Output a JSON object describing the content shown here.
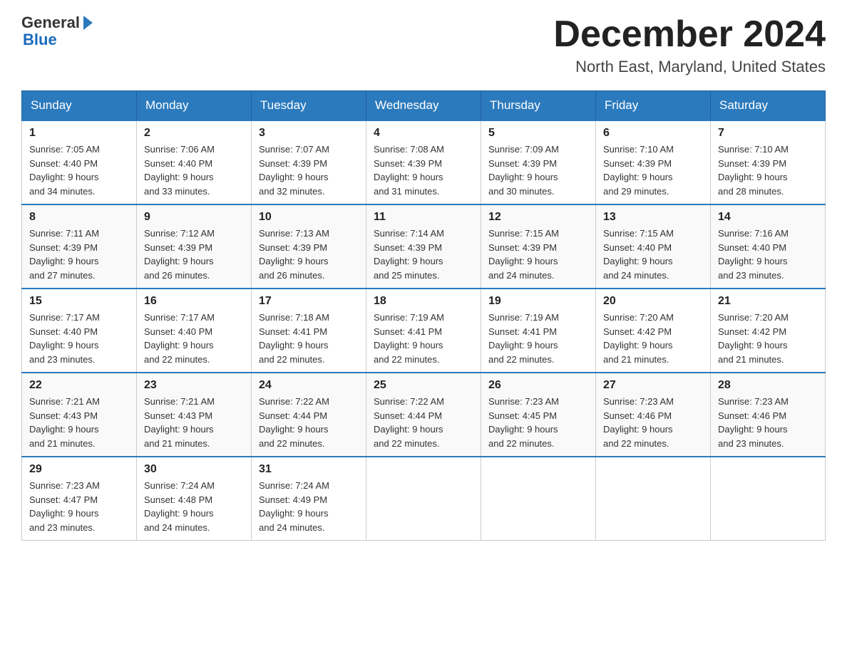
{
  "header": {
    "logo_general": "General",
    "logo_blue": "Blue",
    "month_title": "December 2024",
    "location": "North East, Maryland, United States"
  },
  "weekdays": [
    "Sunday",
    "Monday",
    "Tuesday",
    "Wednesday",
    "Thursday",
    "Friday",
    "Saturday"
  ],
  "weeks": [
    [
      {
        "day": "1",
        "sunrise": "7:05 AM",
        "sunset": "4:40 PM",
        "daylight": "9 hours and 34 minutes."
      },
      {
        "day": "2",
        "sunrise": "7:06 AM",
        "sunset": "4:40 PM",
        "daylight": "9 hours and 33 minutes."
      },
      {
        "day": "3",
        "sunrise": "7:07 AM",
        "sunset": "4:39 PM",
        "daylight": "9 hours and 32 minutes."
      },
      {
        "day": "4",
        "sunrise": "7:08 AM",
        "sunset": "4:39 PM",
        "daylight": "9 hours and 31 minutes."
      },
      {
        "day": "5",
        "sunrise": "7:09 AM",
        "sunset": "4:39 PM",
        "daylight": "9 hours and 30 minutes."
      },
      {
        "day": "6",
        "sunrise": "7:10 AM",
        "sunset": "4:39 PM",
        "daylight": "9 hours and 29 minutes."
      },
      {
        "day": "7",
        "sunrise": "7:10 AM",
        "sunset": "4:39 PM",
        "daylight": "9 hours and 28 minutes."
      }
    ],
    [
      {
        "day": "8",
        "sunrise": "7:11 AM",
        "sunset": "4:39 PM",
        "daylight": "9 hours and 27 minutes."
      },
      {
        "day": "9",
        "sunrise": "7:12 AM",
        "sunset": "4:39 PM",
        "daylight": "9 hours and 26 minutes."
      },
      {
        "day": "10",
        "sunrise": "7:13 AM",
        "sunset": "4:39 PM",
        "daylight": "9 hours and 26 minutes."
      },
      {
        "day": "11",
        "sunrise": "7:14 AM",
        "sunset": "4:39 PM",
        "daylight": "9 hours and 25 minutes."
      },
      {
        "day": "12",
        "sunrise": "7:15 AM",
        "sunset": "4:39 PM",
        "daylight": "9 hours and 24 minutes."
      },
      {
        "day": "13",
        "sunrise": "7:15 AM",
        "sunset": "4:40 PM",
        "daylight": "9 hours and 24 minutes."
      },
      {
        "day": "14",
        "sunrise": "7:16 AM",
        "sunset": "4:40 PM",
        "daylight": "9 hours and 23 minutes."
      }
    ],
    [
      {
        "day": "15",
        "sunrise": "7:17 AM",
        "sunset": "4:40 PM",
        "daylight": "9 hours and 23 minutes."
      },
      {
        "day": "16",
        "sunrise": "7:17 AM",
        "sunset": "4:40 PM",
        "daylight": "9 hours and 22 minutes."
      },
      {
        "day": "17",
        "sunrise": "7:18 AM",
        "sunset": "4:41 PM",
        "daylight": "9 hours and 22 minutes."
      },
      {
        "day": "18",
        "sunrise": "7:19 AM",
        "sunset": "4:41 PM",
        "daylight": "9 hours and 22 minutes."
      },
      {
        "day": "19",
        "sunrise": "7:19 AM",
        "sunset": "4:41 PM",
        "daylight": "9 hours and 22 minutes."
      },
      {
        "day": "20",
        "sunrise": "7:20 AM",
        "sunset": "4:42 PM",
        "daylight": "9 hours and 21 minutes."
      },
      {
        "day": "21",
        "sunrise": "7:20 AM",
        "sunset": "4:42 PM",
        "daylight": "9 hours and 21 minutes."
      }
    ],
    [
      {
        "day": "22",
        "sunrise": "7:21 AM",
        "sunset": "4:43 PM",
        "daylight": "9 hours and 21 minutes."
      },
      {
        "day": "23",
        "sunrise": "7:21 AM",
        "sunset": "4:43 PM",
        "daylight": "9 hours and 21 minutes."
      },
      {
        "day": "24",
        "sunrise": "7:22 AM",
        "sunset": "4:44 PM",
        "daylight": "9 hours and 22 minutes."
      },
      {
        "day": "25",
        "sunrise": "7:22 AM",
        "sunset": "4:44 PM",
        "daylight": "9 hours and 22 minutes."
      },
      {
        "day": "26",
        "sunrise": "7:23 AM",
        "sunset": "4:45 PM",
        "daylight": "9 hours and 22 minutes."
      },
      {
        "day": "27",
        "sunrise": "7:23 AM",
        "sunset": "4:46 PM",
        "daylight": "9 hours and 22 minutes."
      },
      {
        "day": "28",
        "sunrise": "7:23 AM",
        "sunset": "4:46 PM",
        "daylight": "9 hours and 23 minutes."
      }
    ],
    [
      {
        "day": "29",
        "sunrise": "7:23 AM",
        "sunset": "4:47 PM",
        "daylight": "9 hours and 23 minutes."
      },
      {
        "day": "30",
        "sunrise": "7:24 AM",
        "sunset": "4:48 PM",
        "daylight": "9 hours and 24 minutes."
      },
      {
        "day": "31",
        "sunrise": "7:24 AM",
        "sunset": "4:49 PM",
        "daylight": "9 hours and 24 minutes."
      },
      null,
      null,
      null,
      null
    ]
  ],
  "labels": {
    "sunrise": "Sunrise:",
    "sunset": "Sunset:",
    "daylight": "Daylight:"
  }
}
